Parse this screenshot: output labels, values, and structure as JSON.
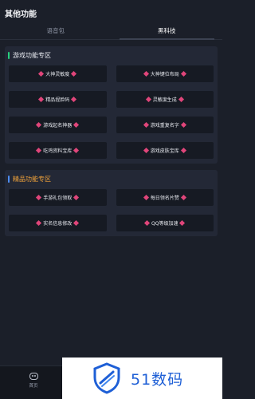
{
  "header": {
    "title": "其他功能"
  },
  "tabs": [
    {
      "label": "语音包",
      "active": false
    },
    {
      "label": "黑科技",
      "active": true
    }
  ],
  "sections": [
    {
      "title": "游戏功能专区",
      "accent": "#27d07d",
      "buttons": [
        "大神灵敏度",
        "大神键位布局",
        "精品捏脸码",
        "灵敏度生成",
        "游戏起名神器",
        "游戏重复名字",
        "吃鸡资料宝库",
        "游戏皮肤宝库"
      ]
    },
    {
      "title": "精品功能专区",
      "accent": "#4d8cf0",
      "title_color": "#f2a33a",
      "buttons": [
        "手游礼包领取",
        "每日领名片赞",
        "实名信息修改",
        "QQ等级加速"
      ]
    }
  ],
  "bottom_nav": {
    "items": [
      {
        "label": "首页",
        "icon": "gamepad-icon"
      }
    ]
  },
  "watermark": {
    "text": "51数码",
    "icon": "shield-logo-icon"
  },
  "colors": {
    "diamond": "#e0457a",
    "background": "#1b1f29"
  }
}
